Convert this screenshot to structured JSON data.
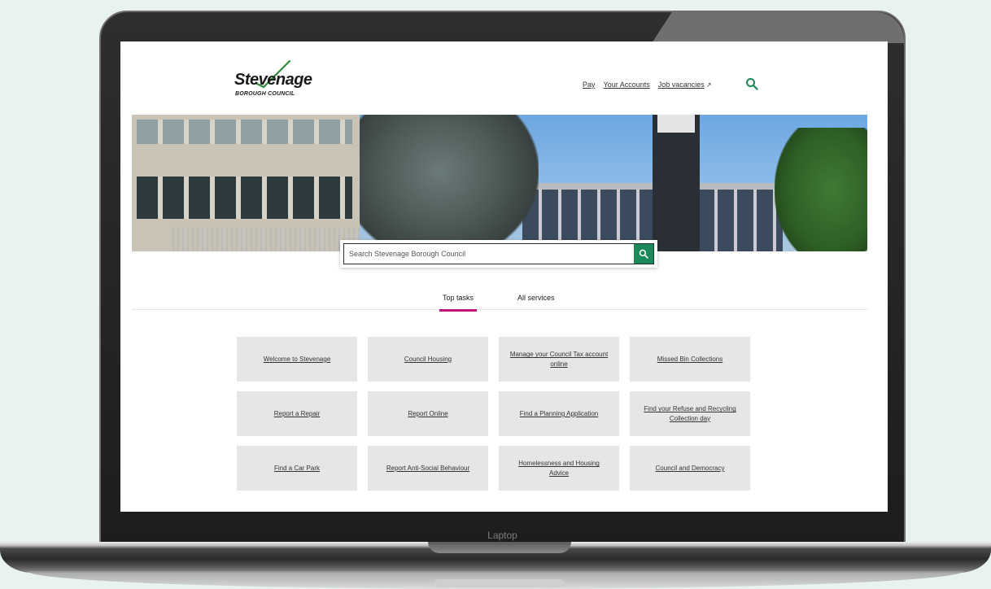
{
  "device": {
    "label": "Laptop"
  },
  "logo": {
    "name": "Stevenage",
    "subtitle": "BOROUGH COUNCIL"
  },
  "utility_nav": [
    {
      "label": "Pay"
    },
    {
      "label": "Your Accounts"
    },
    {
      "label": "Job vacancies",
      "external": true
    }
  ],
  "header_search_icon": "search-icon",
  "search": {
    "placeholder": "Search Stevenage Borough Council"
  },
  "tabs": [
    {
      "label": "Top tasks",
      "active": true
    },
    {
      "label": "All services",
      "active": false
    }
  ],
  "tasks": [
    "Welcome to Stevenage",
    "Council Housing",
    "Manage your Council Tax account online",
    "Missed Bin Collections",
    "Report a Repair",
    "Report Online",
    "Find a Planning Application",
    "Find your Refuse and Recycling Collection day",
    "Find a Car Park",
    "Report Anti-Social Behaviour",
    "Homelessness and Housing Advice",
    "Council and Democracy"
  ],
  "colors": {
    "accent_green": "#1a8a5a",
    "tab_underline": "#c4127a",
    "tile_bg": "#e6e6e6",
    "page_bg": "#e9f3ee"
  }
}
